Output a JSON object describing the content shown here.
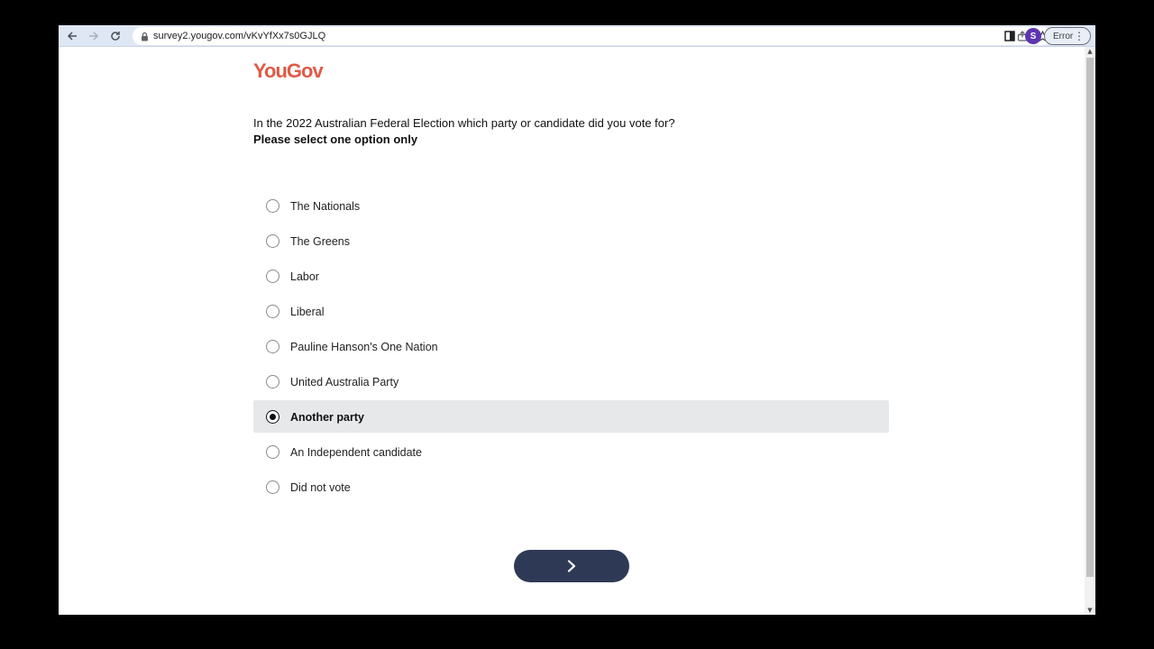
{
  "browser": {
    "url": "survey2.yougov.com/vKvYfXx7s0GJLQ",
    "profile_initial": "S",
    "error_label": "Error",
    "icons": {
      "back": "arrow-left-icon",
      "forward": "arrow-right-icon",
      "reload": "reload-icon",
      "lock": "lock-icon",
      "share": "share-icon",
      "bookmark": "star-icon",
      "sidepanel": "side-panel-icon",
      "menu": "kebab-menu-icon"
    }
  },
  "page": {
    "logo_text": "YouGov",
    "brand_color": "#e05a47",
    "question": "In the 2022 Australian Federal Election which party or candidate did you vote for?",
    "instruction": "Please select one option only",
    "options": [
      {
        "label": "The Nationals",
        "selected": false
      },
      {
        "label": "The Greens",
        "selected": false
      },
      {
        "label": "Labor",
        "selected": false
      },
      {
        "label": "Liberal",
        "selected": false
      },
      {
        "label": "Pauline Hanson's One Nation",
        "selected": false
      },
      {
        "label": "United Australia Party",
        "selected": false
      },
      {
        "label": "Another party",
        "selected": true
      },
      {
        "label": "An Independent candidate",
        "selected": false
      },
      {
        "label": "Did not vote",
        "selected": false
      }
    ],
    "next_button_icon": "chevron-right-icon",
    "next_button_color": "#2e3a55"
  }
}
